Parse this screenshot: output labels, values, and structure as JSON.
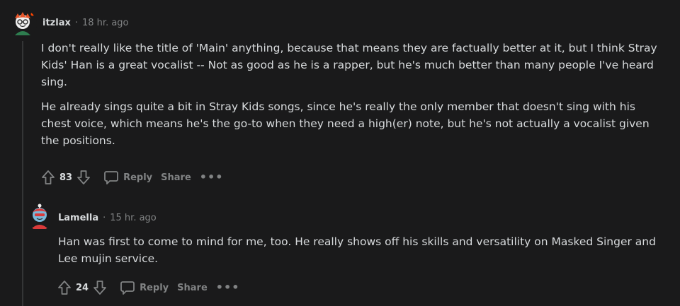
{
  "comments": [
    {
      "username": "itzlax",
      "time": "18 hr. ago",
      "paragraphs": [
        "I don't really like the title of 'Main' anything, because that means they are factually better at it, but I think Stray Kids' Han is a great vocalist -- Not as good as he is a rapper, but he's much better than many people I've heard sing.",
        "He already sings quite a bit in Stray Kids songs, since he's really the only member that doesn't sing with his chest voice, which means he's the go-to when they need a high(er) note, but he's not actually a vocalist given the positions."
      ],
      "votes": "83",
      "reply_label": "Reply",
      "share_label": "Share",
      "more_label": "•••"
    },
    {
      "username": "Lamella",
      "time": "15 hr. ago",
      "paragraphs": [
        "Han was first to come to mind for me, too. He really shows off his skills and versatility on Masked Singer and Lee mujin service."
      ],
      "votes": "24",
      "reply_label": "Reply",
      "share_label": "Share",
      "more_label": "•••"
    }
  ],
  "meta_separator": "·",
  "colors": {
    "background": "#1a1a1b",
    "text": "#d7dadc",
    "muted": "#818384",
    "thread_line": "#343536"
  }
}
